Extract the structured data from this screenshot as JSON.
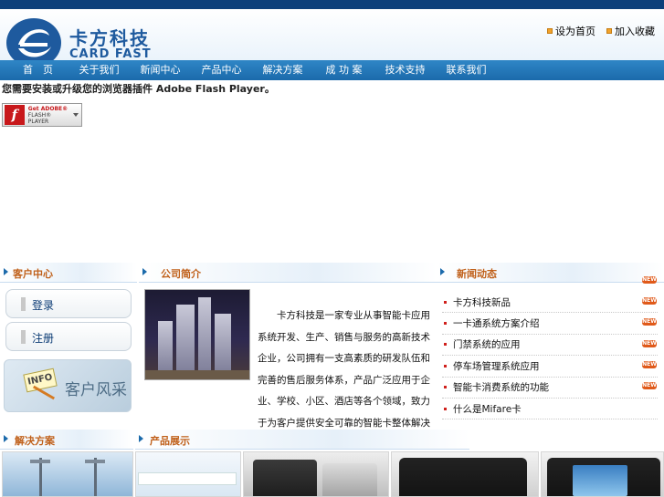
{
  "header": {
    "brand_cn": "卡方科技",
    "brand_en": "CARD FAST",
    "links": [
      {
        "label": "设为首页"
      },
      {
        "label": "加入收藏"
      }
    ]
  },
  "nav": {
    "items": [
      {
        "label": "首　页"
      },
      {
        "label": "关于我们"
      },
      {
        "label": "新闻中心"
      },
      {
        "label": "产品中心"
      },
      {
        "label": "解决方案"
      },
      {
        "label": "成 功 案"
      },
      {
        "label": "技术支持"
      },
      {
        "label": "联系我们"
      }
    ]
  },
  "flash": {
    "message": "您需要安装或升级您的浏览器插件 Adobe Flash Player。",
    "button_line1": "Get ADOBE®",
    "button_line2": "FLASH® PLAYER"
  },
  "sections": {
    "left": "客户中心",
    "middle": "公司简介",
    "right": "新闻动态",
    "bottom_left": "解决方案",
    "bottom_middle": "产品展示"
  },
  "side_buttons": [
    {
      "label": "登录"
    },
    {
      "label": "注册"
    }
  ],
  "client_banner": {
    "badge": "INFO",
    "text": "客户风采"
  },
  "intro": {
    "text": "卡方科技是一家专业从事智能卡应用系统开发、生产、销售与服务的高新技术企业，公司拥有一支高素质的研发队伍和完善的售后服务体系，产品广泛应用于企业、学校、小区、酒店等各个领域，致力于为客户提供安全可靠的智能卡整体解决方案..."
  },
  "news": {
    "items": [
      {
        "title": "卡方科技新品"
      },
      {
        "title": "一卡通系统方案介绍"
      },
      {
        "title": "门禁系统的应用"
      },
      {
        "title": "停车场管理系统应用"
      },
      {
        "title": "智能卡消费系统的功能"
      },
      {
        "title": "什么是Mifare卡"
      }
    ],
    "badge": "NEW"
  },
  "colors": {
    "brand_blue": "#1e5a9e",
    "nav_blue": "#1b6aab",
    "section_title": "#c0601a",
    "badge": "#e05a1a"
  }
}
